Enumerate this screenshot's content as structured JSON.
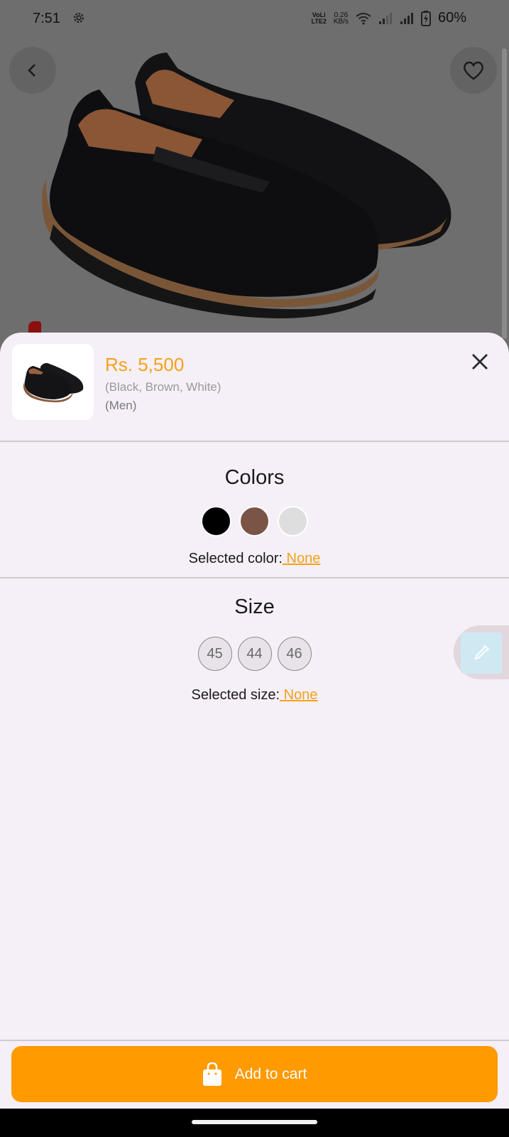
{
  "status_bar": {
    "time": "7:51",
    "net_top": "0.26",
    "net_bottom": "KB/s",
    "volte_top": "VoLi",
    "volte_bottom": "LTE2",
    "battery": "60%"
  },
  "product": {
    "price": "Rs. 5,500",
    "variants": "(Black, Brown, White)",
    "gender": "(Men)"
  },
  "colors": {
    "title": "Colors",
    "swatches": [
      "#000000",
      "#7a5546",
      "#dedede"
    ],
    "selected_label": "Selected color:",
    "selected_value": " None"
  },
  "size": {
    "title": "Size",
    "options": [
      "45",
      "44",
      "46"
    ],
    "selected_label": "Selected size:",
    "selected_value": " None"
  },
  "cart": {
    "label": "Add to cart"
  },
  "accent_color": "#ff9a00"
}
